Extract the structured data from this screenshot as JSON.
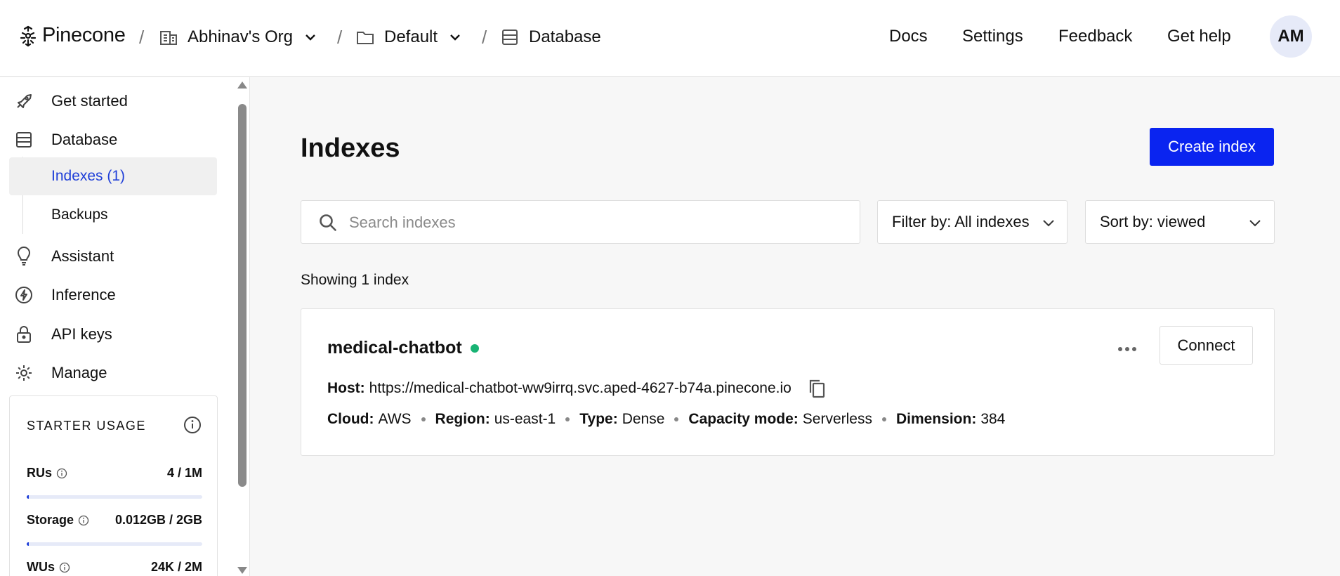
{
  "header": {
    "brand": "Pinecone",
    "breadcrumb": [
      {
        "label": "Abhinav's Org",
        "icon": "building-icon"
      },
      {
        "label": "Default",
        "icon": "folder-icon"
      },
      {
        "label": "Database",
        "icon": "database-icon"
      }
    ],
    "separator": "/",
    "nav": [
      "Docs",
      "Settings",
      "Feedback",
      "Get help"
    ],
    "avatar_initials": "AM"
  },
  "sidebar": {
    "items": [
      {
        "label": "Get started",
        "icon": "rocket-icon"
      },
      {
        "label": "Database",
        "icon": "database-icon"
      },
      {
        "label": "Indexes (1)",
        "active": true
      },
      {
        "label": "Backups"
      },
      {
        "label": "Assistant",
        "icon": "lightbulb-icon"
      },
      {
        "label": "Inference",
        "icon": "bolt-icon"
      },
      {
        "label": "API keys",
        "icon": "lock-icon"
      },
      {
        "label": "Manage",
        "icon": "gear-icon"
      }
    ],
    "usage": {
      "title": "STARTER USAGE",
      "rows": [
        {
          "name": "RUs",
          "value": "4 / 1M",
          "fraction": 4e-06
        },
        {
          "name": "Storage",
          "value": "0.012GB / 2GB",
          "fraction": 0.006
        },
        {
          "name": "WUs",
          "value": "24K / 2M",
          "fraction": 0.012
        }
      ]
    }
  },
  "main": {
    "title": "Indexes",
    "create_label": "Create index",
    "search_placeholder": "Search indexes",
    "filter_label": "Filter by: All indexes",
    "sort_label": "Sort by: viewed",
    "showing": "Showing 1 index",
    "index": {
      "name": "medical-chatbot",
      "status_color": "#18b374",
      "connect_label": "Connect",
      "host_label": "Host:",
      "host": "https://medical-chatbot-ww9irrq.svc.aped-4627-b74a.pinecone.io",
      "meta": [
        {
          "label": "Cloud:",
          "value": "AWS"
        },
        {
          "label": "Region:",
          "value": "us-east-1"
        },
        {
          "label": "Type:",
          "value": "Dense"
        },
        {
          "label": "Capacity mode:",
          "value": "Serverless"
        },
        {
          "label": "Dimension:",
          "value": "384"
        }
      ]
    }
  },
  "colors": {
    "accent": "#0a24f0",
    "active_text": "#1f3fd8",
    "status": "#18b374"
  }
}
